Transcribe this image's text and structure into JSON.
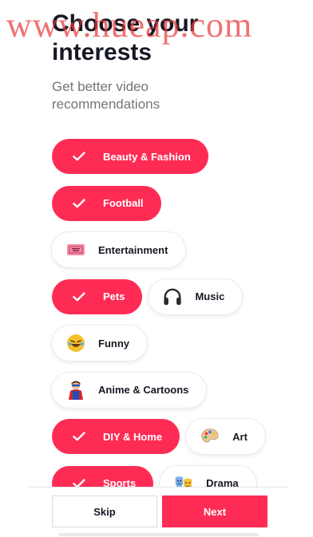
{
  "watermark": "www.hueap.com",
  "header": {
    "title": "Choose your interests",
    "subtitle": "Get better video recommendations"
  },
  "interests": [
    [
      {
        "label": "Beauty & Fashion",
        "selected": true,
        "icon": "check-icon"
      }
    ],
    [
      {
        "label": "Football",
        "selected": true,
        "icon": "check-icon"
      }
    ],
    [
      {
        "label": "Entertainment",
        "selected": false,
        "icon": "ticket-icon"
      }
    ],
    [
      {
        "label": "Pets",
        "selected": true,
        "icon": "check-icon"
      },
      {
        "label": "Music",
        "selected": false,
        "icon": "headphones-icon"
      }
    ],
    [
      {
        "label": "Funny",
        "selected": false,
        "icon": "laughing-emoji-icon"
      }
    ],
    [
      {
        "label": "Anime & Cartoons",
        "selected": false,
        "icon": "superhero-icon"
      }
    ],
    [
      {
        "label": "DIY & Home",
        "selected": true,
        "icon": "check-icon"
      },
      {
        "label": "Art",
        "selected": false,
        "icon": "palette-icon"
      }
    ],
    [
      {
        "label": "Sports",
        "selected": true,
        "icon": "check-icon"
      },
      {
        "label": "Drama",
        "selected": false,
        "icon": "theater-masks-icon"
      }
    ]
  ],
  "footer": {
    "skip_label": "Skip",
    "next_label": "Next"
  },
  "colors": {
    "accent": "#fe2c55",
    "text": "#161823",
    "subtext": "#74757c"
  }
}
